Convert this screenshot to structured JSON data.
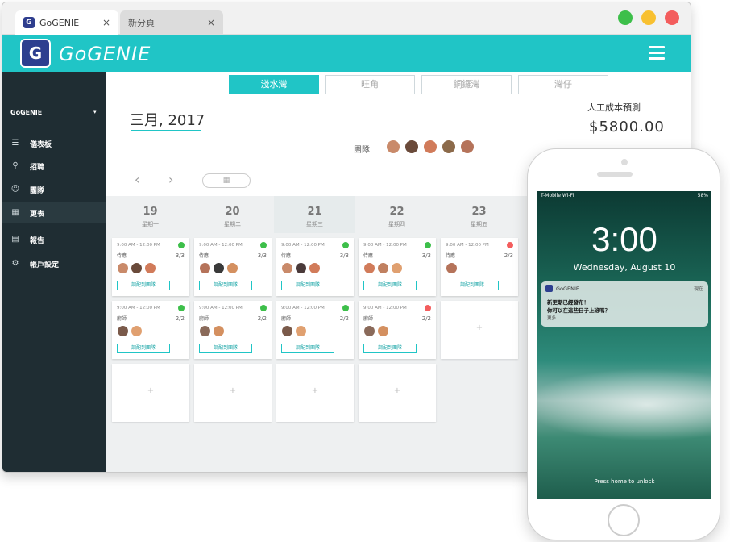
{
  "browser": {
    "tabs": [
      {
        "label": "GoGENIE",
        "favicon": "G"
      },
      {
        "label": "新分頁"
      }
    ],
    "close_glyph": "×",
    "window_buttons": [
      "#3dbf4a",
      "#f8c030",
      "#f35d5d"
    ]
  },
  "app": {
    "logo_glyph": "G",
    "logo_text": "GoGENIE",
    "accent": "#20c5c6"
  },
  "sidebar": {
    "org": "GoGENIE",
    "org_caret": "▾",
    "items": [
      {
        "label": "儀表板",
        "icon": "dashboard-icon",
        "glyph": "☰"
      },
      {
        "label": "招聘",
        "icon": "recruit-icon",
        "glyph": "⚲"
      },
      {
        "label": "團隊",
        "icon": "team-icon",
        "glyph": "☺"
      },
      {
        "label": "更表",
        "icon": "schedule-icon",
        "glyph": "▦"
      },
      {
        "label": "報告",
        "icon": "report-icon",
        "glyph": "▤"
      },
      {
        "label": "帳戶設定",
        "icon": "settings-icon",
        "glyph": "⚙"
      }
    ]
  },
  "locations": [
    "淺水灣",
    "旺角",
    "銅鑼灣",
    "灣仔"
  ],
  "header": {
    "month": "三月, 2017",
    "cost_label": "人工成本預測",
    "cost_value": "$5800.00",
    "team_label": "團隊",
    "team_avatars": [
      "#c98a6a",
      "#6a4a3a",
      "#d17b5a",
      "#8c6a4a",
      "#b5735a"
    ],
    "prev": "‹",
    "next": "›",
    "calendar_glyph": "▦"
  },
  "days": [
    {
      "num": "19",
      "weekday": "星期一"
    },
    {
      "num": "20",
      "weekday": "星期二"
    },
    {
      "num": "21",
      "weekday": "星期三"
    },
    {
      "num": "22",
      "weekday": "星期四"
    },
    {
      "num": "23",
      "weekday": "星期五"
    }
  ],
  "shifts_row1": [
    {
      "time": "9:00 AM - 12:00 PM",
      "role": "侍應",
      "ratio": "3/3",
      "status": "#3dbf4a",
      "avatars": [
        "#c98a6a",
        "#6a4a3a",
        "#d17b5a"
      ],
      "assign": "調配到團隊"
    },
    {
      "time": "9:00 AM - 12:00 PM",
      "role": "侍應",
      "ratio": "3/3",
      "status": "#3dbf4a",
      "avatars": [
        "#b5735a",
        "#3a3a3a",
        "#d49060"
      ],
      "assign": "調配到團隊"
    },
    {
      "time": "9:00 AM - 12:00 PM",
      "role": "侍應",
      "ratio": "3/3",
      "status": "#3dbf4a",
      "avatars": [
        "#c98a6a",
        "#4a3a3a",
        "#d17b5a"
      ],
      "assign": "調配到團隊"
    },
    {
      "time": "9:00 AM - 12:00 PM",
      "role": "侍應",
      "ratio": "3/3",
      "status": "#3dbf4a",
      "avatars": [
        "#d17b5a",
        "#c08060",
        "#e0a070"
      ],
      "assign": "調配到團隊"
    },
    {
      "time": "9:00 AM - 12:00 PM",
      "role": "侍應",
      "ratio": "2/3",
      "status": "#f35d5d",
      "avatars": [
        "#b5735a"
      ],
      "assign": "調配到團隊"
    }
  ],
  "shifts_row2": [
    {
      "time": "9:00 AM - 12:00 PM",
      "role": "廚師",
      "ratio": "2/2",
      "status": "#3dbf4a",
      "avatars": [
        "#7a5a4a",
        "#e0a070"
      ],
      "assign": "調配到團隊"
    },
    {
      "time": "9:00 AM - 12:00 PM",
      "role": "廚師",
      "ratio": "2/2",
      "status": "#3dbf4a",
      "avatars": [
        "#8a6a5a",
        "#d49060"
      ],
      "assign": "調配到團隊"
    },
    {
      "time": "9:00 AM - 12:00 PM",
      "role": "廚師",
      "ratio": "2/2",
      "status": "#3dbf4a",
      "avatars": [
        "#7a5a4a",
        "#e0a070"
      ],
      "assign": "調配到團隊"
    },
    {
      "time": "9:00 AM - 12:00 PM",
      "role": "廚師",
      "ratio": "2/2",
      "status": "#f35d5d",
      "avatars": [
        "#8a6a5a",
        "#d49060"
      ],
      "assign": "調配到團隊"
    }
  ],
  "add_glyph": "+",
  "phone": {
    "carrier": "T-Mobile Wi-Fi",
    "battery": "58%",
    "time": "3:00",
    "date": "Wednesday, August 10",
    "notif_app": "GoGENIE",
    "notif_when": "現在",
    "notif_line1": "新更期已經發布！",
    "notif_line2": "你可以在這些日子上班嗎？",
    "notif_more": "更多",
    "unlock": "Press home to unlock"
  }
}
